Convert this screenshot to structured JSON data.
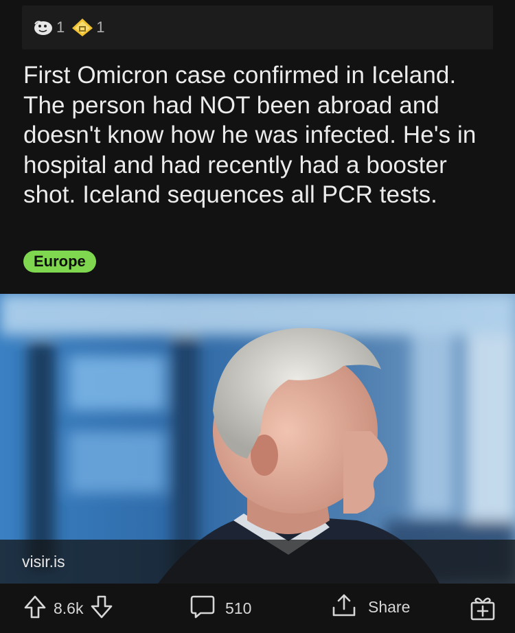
{
  "awards": [
    {
      "icon": "wholesome-seal-award-icon",
      "count": "1"
    },
    {
      "icon": "gold-trophy-award-icon",
      "count": "1"
    }
  ],
  "post": {
    "title": "First Omicron case confirmed in Iceland. The person had NOT been abroad and doesn't know how he was infected. He's in hospital and had recently had a booster shot. Iceland sequences all PCR tests.",
    "flair": "Europe",
    "flair_color": "#7fd64f",
    "link_domain": "visir.is"
  },
  "actions": {
    "score": "8.6k",
    "comments": "510",
    "share_label": "Share"
  },
  "colors": {
    "background": "#121212",
    "text": "#ececec",
    "muted": "#d7d7d7"
  }
}
